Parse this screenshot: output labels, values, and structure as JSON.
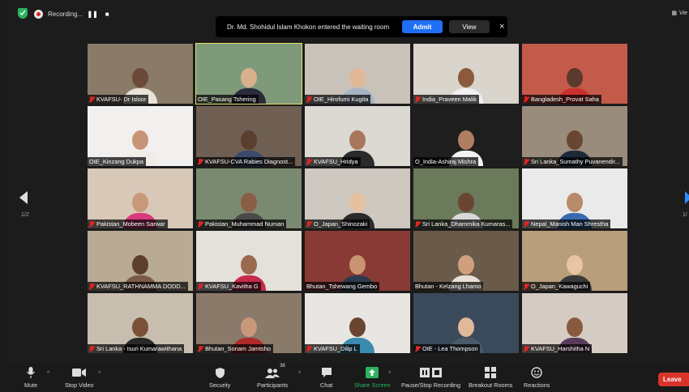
{
  "recording": {
    "label": "Recording..."
  },
  "notification": {
    "text": "Dr. Md. Shohidul Islam Khokon entered the waiting room",
    "admit": "Admit",
    "view": "View",
    "close": "×"
  },
  "view_menu": {
    "label": "Vie"
  },
  "paging": {
    "left": "1/2",
    "right": "1/"
  },
  "participants": [
    {
      "name": "KVAFSU- Dr Isloor",
      "muted": true,
      "bg": "#8a7a68",
      "skin": "#6b4a38",
      "shirt": "#e8e2d8"
    },
    {
      "name": "OIE_Pasang Tshering",
      "muted": false,
      "active": true,
      "bg": "#7f9a7a",
      "skin": "#d8b08c",
      "shirt": "#2a2a3a"
    },
    {
      "name": "OIE_Hirofumi Kugita",
      "muted": true,
      "bg": "#c9c2b9",
      "skin": "#e0b896",
      "shirt": "#a8b4c4"
    },
    {
      "name": "India_Praveen Malik",
      "muted": true,
      "bg": "#d9d4cc",
      "skin": "#8b5a3c",
      "shirt": "#f0f0f0"
    },
    {
      "name": "Bangladesh_Provat Saha",
      "muted": true,
      "bg": "#c45a4a",
      "skin": "#5a3a2a",
      "shirt": "#c92f2f"
    },
    {
      "name": "OIE_Kinzang Dukpa",
      "muted": false,
      "bg": "#f2f0ee",
      "skin": "#c89478",
      "shirt": "#f0ece6"
    },
    {
      "name": "KVAFSU-CVA Rabies Diagnost...",
      "muted": true,
      "bg": "#6e5f52",
      "skin": "#5a3e2e",
      "shirt": "#3c4a6a"
    },
    {
      "name": "KVAFSU_Hridya",
      "muted": true,
      "bg": "#dcd8d2",
      "skin": "#a8765a",
      "shirt": "#2a2a2a"
    },
    {
      "name": "O_India-Ashiraj Mishra",
      "muted": false,
      "bg": "#1e1e1e",
      "skin": "#b07e60",
      "shirt": "#f2f2f2"
    },
    {
      "name": "Sri Lanka_Sumathy Puvanendir...",
      "muted": true,
      "bg": "#9a8c7c",
      "skin": "#6a4632",
      "shirt": "#1e2a3a"
    },
    {
      "name": "Pakistan_Mobeen Sarwar",
      "muted": true,
      "bg": "#d8c8b8",
      "skin": "#c8987a",
      "shirt": "#d83a7a"
    },
    {
      "name": "Pakistan_Muhammad Numan",
      "muted": true,
      "bg": "#7a8a70",
      "skin": "#8a5e44",
      "shirt": "#4a4a4a"
    },
    {
      "name": "O_Japan_Shinozaki",
      "muted": true,
      "bg": "#cfc8c0",
      "skin": "#e6c0a0",
      "shirt": "#2a2a2a"
    },
    {
      "name": "Sri Lanka_Dhammika Kumaras...",
      "muted": true,
      "bg": "#6a7a5a",
      "skin": "#6a4632",
      "shirt": "#d8d8d8"
    },
    {
      "name": "Nepal_Manish Man Shrestha",
      "muted": true,
      "bg": "#eaeaea",
      "skin": "#b88a6a",
      "shirt": "#3a6ab0"
    },
    {
      "name": "KVAFSU_RATHNAMMA DODD...",
      "muted": true,
      "bg": "#b8aa94",
      "skin": "#5e3e2c",
      "shirt": "#7a5a4a"
    },
    {
      "name": "KVAFSU_Kavitha G",
      "muted": true,
      "bg": "#e4e0da",
      "skin": "#9a6a4e",
      "shirt": "#c82a4a"
    },
    {
      "name": "Bhutan_Tshewang Gembo",
      "muted": false,
      "bg": "#8a3a34",
      "skin": "#c89472",
      "shirt": "#2e3a4e"
    },
    {
      "name": "Bhutan - Kelzang Lhamo",
      "muted": false,
      "bg": "#6a5a4a",
      "skin": "#d0a07e",
      "shirt": "#e8e0d4"
    },
    {
      "name": "O_Japan_Kawaguchi",
      "muted": true,
      "bg": "#b89e7a",
      "skin": "#e8c4a4",
      "shirt": "#3a3a3a"
    },
    {
      "name": "Sri Lanka - Isuri Kumarawithana",
      "muted": true,
      "bg": "#c8beb0",
      "skin": "#7a5038",
      "shirt": "#2a2a2a"
    },
    {
      "name": "Bhutan_Sonam Jamtsho",
      "muted": true,
      "bg": "#8a7a6a",
      "skin": "#c8987a",
      "shirt": "#b02a2a"
    },
    {
      "name": "KVAFSU_Dilip L",
      "muted": true,
      "bg": "#e8e6e2",
      "skin": "#6a4632",
      "shirt": "#3a8ab0"
    },
    {
      "name": "OIE - Lea Thompson",
      "muted": true,
      "bg": "#3a4a5a",
      "skin": "#e0b89a",
      "shirt": "#4a5a6a"
    },
    {
      "name": "KVAFSU_Harshitha N",
      "muted": true,
      "bg": "#d4ccc2",
      "skin": "#8a5a3e",
      "shirt": "#5a3a5a"
    }
  ],
  "toolbar": {
    "mute": "Mute",
    "stop_video": "Stop Video",
    "security": "Security",
    "participants": "Participants",
    "participants_count": "38",
    "chat": "Chat",
    "share_screen": "Share Screen",
    "recording": "Pause/Stop Recording",
    "breakout": "Breakout Rooms",
    "reactions": "Reactions",
    "leave": "Leave"
  }
}
